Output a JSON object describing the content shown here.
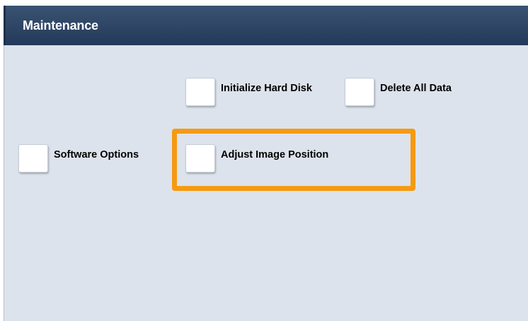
{
  "header": {
    "title": "Maintenance"
  },
  "options": {
    "initialize_hard_disk": "Initialize Hard Disk",
    "delete_all_data": "Delete All Data",
    "software_options": "Software Options",
    "adjust_image_position": "Adjust Image Position"
  },
  "colors": {
    "title_bar": "#2d4566",
    "panel_background": "#dde3ec",
    "highlight": "#f59a12"
  }
}
